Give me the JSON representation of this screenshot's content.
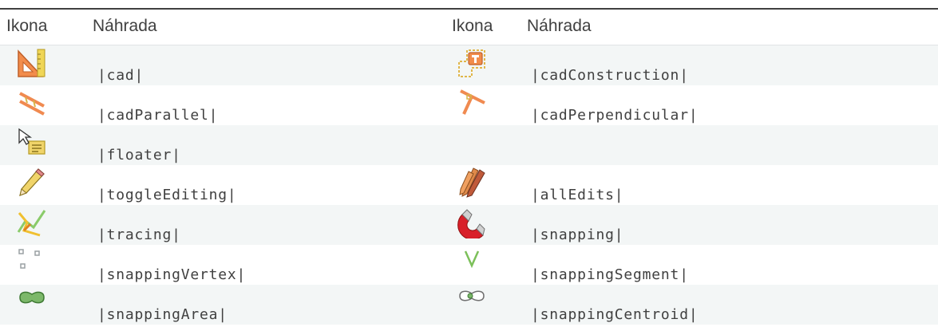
{
  "header": {
    "col1": "Ikona",
    "col2": "Náhrada",
    "col3": "Ikona",
    "col4": "Náhrada"
  },
  "rows": [
    {
      "left": {
        "icon": "cad-icon",
        "text": "|cad|"
      },
      "right": {
        "icon": "cad-construction-icon",
        "text": "|cadConstruction|"
      }
    },
    {
      "left": {
        "icon": "cad-parallel-icon",
        "text": "|cadParallel|"
      },
      "right": {
        "icon": "cad-perpendicular-icon",
        "text": "|cadPerpendicular|"
      }
    },
    {
      "left": {
        "icon": "floater-icon",
        "text": "|floater|"
      },
      "right": {
        "icon": "",
        "text": ""
      }
    },
    {
      "left": {
        "icon": "toggle-editing-icon",
        "text": "|toggleEditing|"
      },
      "right": {
        "icon": "all-edits-icon",
        "text": "|allEdits|"
      }
    },
    {
      "left": {
        "icon": "tracing-icon",
        "text": "|tracing|"
      },
      "right": {
        "icon": "snapping-icon",
        "text": "|snapping|"
      }
    },
    {
      "left": {
        "icon": "snapping-vertex-icon",
        "text": "|snappingVertex|"
      },
      "right": {
        "icon": "snapping-segment-icon",
        "text": "|snappingSegment|"
      }
    },
    {
      "left": {
        "icon": "snapping-area-icon",
        "text": "|snappingArea|"
      },
      "right": {
        "icon": "snapping-centroid-icon",
        "text": "|snappingCentroid|"
      }
    }
  ]
}
